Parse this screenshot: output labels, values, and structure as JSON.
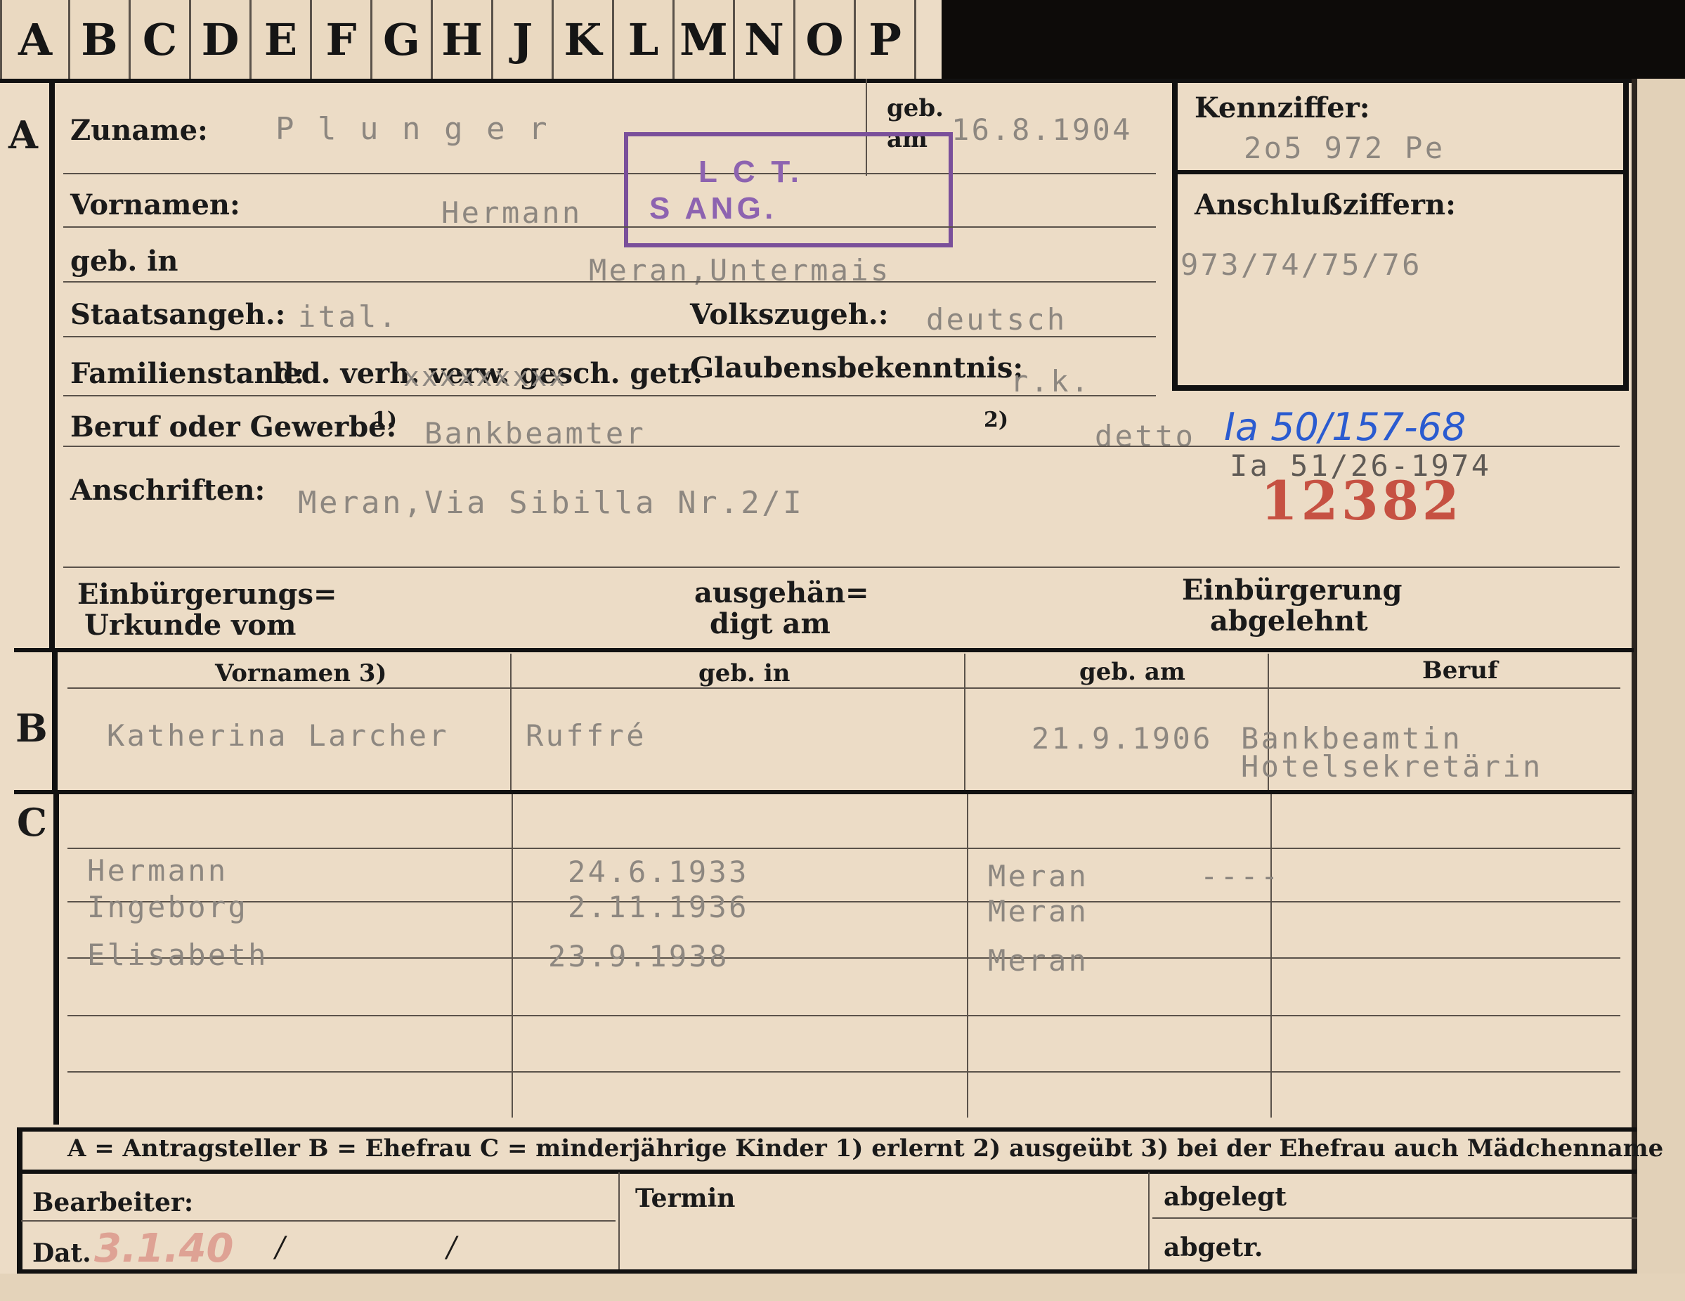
{
  "tabs": [
    "A",
    "B",
    "C",
    "D",
    "E",
    "F",
    "G",
    "H",
    "J",
    "K",
    "L",
    "M",
    "N",
    "O",
    "P"
  ],
  "section_a": {
    "marker": "A",
    "surname_label": "Zuname:",
    "surname": "P l u n g e r",
    "birthdate_label_1": "geb.",
    "birthdate_label_2": "am",
    "birthdate": "16.8.1904",
    "firstname_label": "Vornamen:",
    "firstname": "Hermann",
    "birthplace_label": "geb. in",
    "birthplace": "Meran,Untermais",
    "citizenship_label": "Staatsangeh.:",
    "citizenship": "ital.",
    "ethnicity_label": "Volkszugeh.:",
    "ethnicity": "deutsch",
    "marital_label": "Familienstand:",
    "marital_options": "led. verh. verw. gesch. getr.",
    "marital_overstrike": "xxxxxxxxx",
    "religion_label": "Glaubensbekenntnis:",
    "religion": "r.k.",
    "profession_label": "Beruf oder Gewerbe:",
    "profession_note_1": "1)",
    "profession_learned": "Bankbeamter",
    "profession_note_2": "2)",
    "profession_practiced": "detto",
    "file_ref_handwritten": "Ia 50/157-68",
    "file_ref_typed": "Ia 51/26-1974",
    "red_number": "12382",
    "address_label": "Anschriften:",
    "address": "Meran,Via Sibilla Nr.2/I",
    "naturalization_cert_label_1": "Einbürgerungs=",
    "naturalization_cert_label_2": "Urkunde vom",
    "handed_label_1": "ausgehän=",
    "handed_label_2": "digt am",
    "rejected_label_1": "Einbürgerung",
    "rejected_label_2": "abgelehnt"
  },
  "id_box": {
    "code_label": "Kennziffer:",
    "code": "2o5 972 Pe",
    "connect_label": "Anschlußziffern:",
    "connect": "973/74/75/76"
  },
  "stamp": {
    "line1": "L  C T.",
    "line2": "S     ANG."
  },
  "section_b": {
    "marker": "B",
    "headers": [
      "Vornamen 3)",
      "geb. in",
      "geb. am",
      "Beruf"
    ],
    "name": "Katherina Larcher",
    "place": "Ruffré",
    "date": "21.9.1906",
    "job_1": "Bankbeamtin",
    "job_2": "Hotelsekretärin"
  },
  "section_c": {
    "marker": "C",
    "children": [
      {
        "name": "Hermann",
        "date": "24.6.1933",
        "place": "Meran",
        "extra": "----"
      },
      {
        "name": "Ingeborg",
        "date": "2.11.1936",
        "place": "Meran",
        "extra": ""
      },
      {
        "name": "Elisabeth",
        "date": "23.9.1938",
        "place": "Meran",
        "extra": ""
      }
    ]
  },
  "legend": "A = Antragsteller   B = Ehefrau   C = minderjährige Kinder   1) erlernt   2) ausgeübt   3) bei der Ehefrau auch Mädchenname",
  "footer": {
    "processor_label": "Bearbeiter:",
    "date_label": "Dat.",
    "date_value": "3.1.40",
    "slash1": "/",
    "slash2": "/",
    "term_label": "Termin",
    "filed_label": "abgelegt",
    "sent_label": "abgetr."
  },
  "colors": {
    "paper": "#ecdcc6",
    "ink": "#1c1a18",
    "typewriter": "#8d8780",
    "stamp": "#7a4f9a",
    "red_number": "#c0392b",
    "blue_ink": "#2a5bd0"
  }
}
